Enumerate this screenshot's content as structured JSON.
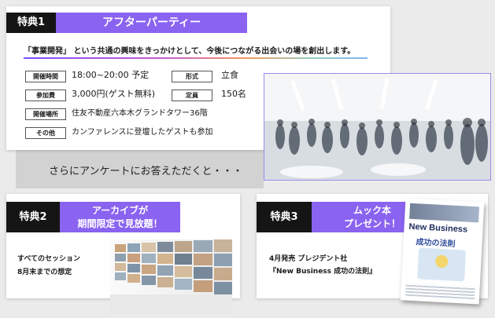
{
  "perk1": {
    "badge": "特典1",
    "title": "アフターパーティー",
    "intro": "「事業開発」 という共通の興味をきっかけとして、今後につながる出会いの場を創出します。",
    "rows": {
      "time_label": "開催時間",
      "time_value": "18:00~20:00 予定",
      "format_label": "形式",
      "format_value": "立食",
      "fee_label": "参加費",
      "fee_value": "3,000円(ゲスト無料)",
      "capacity_label": "定員",
      "capacity_value": "150名",
      "venue_label": "開催場所",
      "venue_value": "住友不動産六本木グランドタワー36階",
      "other_label": "その他",
      "other_value": "カンファレンスに登壇したゲストも参加"
    }
  },
  "banner": {
    "text": "さらにアンケートにお答えただくと・・・"
  },
  "perk2": {
    "badge": "特典2",
    "title_line1": "アーカイブが",
    "title_line2": "期間限定で見放題！",
    "body_line1": "すべてのセッション",
    "body_line2": "8月末までの想定"
  },
  "perk3": {
    "badge": "特典3",
    "title_line1": "ムック本",
    "title_line2": "プレゼント！",
    "body_line1": "4月発売 プレジデント社",
    "body_line2": "『New Business 成功の法則』"
  },
  "book": {
    "title_en": "New Business",
    "title_jp": "成功の法則"
  },
  "colors": {
    "accent": "#8a63f0",
    "badge_bg": "#151515"
  }
}
